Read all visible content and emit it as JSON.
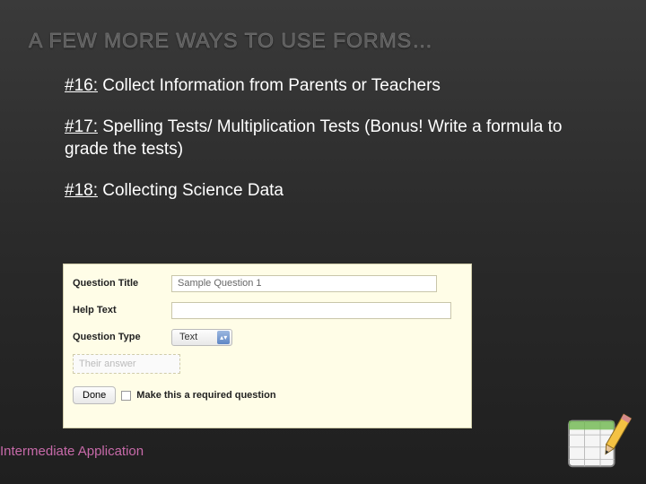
{
  "title": "A FEW MORE WAYS TO USE FORMS…",
  "items": [
    {
      "num": "#16:",
      "text": " Collect Information from Parents or Teachers"
    },
    {
      "num": "#17:",
      "text": " Spelling Tests/ Multiplication Tests (Bonus! Write a formula to grade the tests)"
    },
    {
      "num": "#18:",
      "text": " Collecting Science Data"
    }
  ],
  "form": {
    "labels": {
      "questionTitle": "Question Title",
      "helpText": "Help Text",
      "questionType": "Question Type"
    },
    "titleValue": "Sample Question 1",
    "helpValue": "",
    "typeValue": "Text",
    "answerPlaceholder": "Their answer",
    "doneLabel": "Done",
    "requiredLabel": "Make this a required question"
  },
  "footer": "Intermediate Application"
}
